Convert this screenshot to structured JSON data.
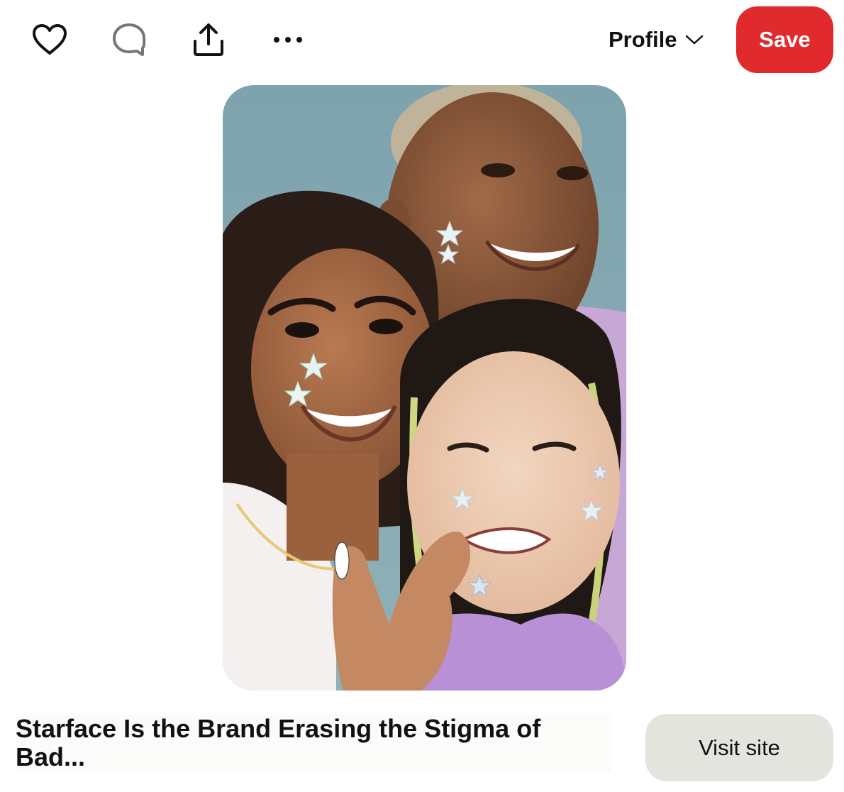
{
  "toolbar": {
    "like_icon": "heart-icon",
    "comment_icon": "comment-bubble-icon",
    "share_icon": "share-upload-icon",
    "more_icon": "more-dots-icon",
    "profile_label": "Profile",
    "profile_chevron_icon": "chevron-down-icon",
    "save_label": "Save",
    "save_color": "#e02a2d"
  },
  "pin": {
    "image_icon": "pin-photo",
    "expand_icon": "expand-arrows-icon",
    "title": "Starface Is the Brand Erasing the Stigma of Bad...",
    "visit_label": "Visit site"
  }
}
